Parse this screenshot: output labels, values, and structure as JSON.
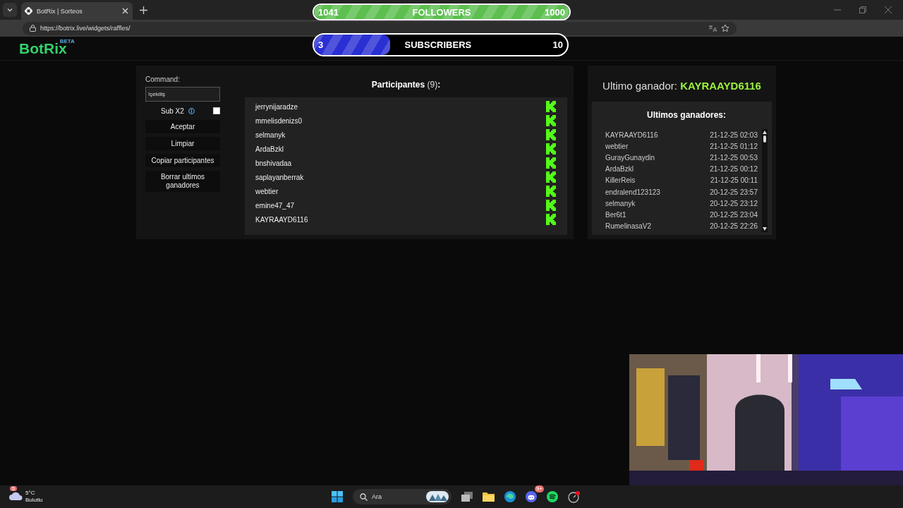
{
  "browser": {
    "tab_title": "BotRix | Sorteos",
    "url": "https://botrix.live/widgets/raffles/"
  },
  "goals": [
    {
      "current": "1041",
      "label": "FOLLOWERS",
      "target": "1000",
      "level": 1,
      "color": "#5cbf4f"
    },
    {
      "current": "3",
      "label": "SUBSCRIBERS",
      "target": "10",
      "level": 0.3,
      "color": "#2a2fd4"
    }
  ],
  "site": {
    "logo": "BotRix",
    "badge": "BETA"
  },
  "raffle": {
    "command_label": "Command:",
    "command_value": "!çekiliş",
    "sub_x2": {
      "label": "Sub X2",
      "checked": false
    },
    "buttons": [
      "Aceptar",
      "Limpiar",
      "Copiar participantes",
      "Borrar ultimos ganadores"
    ],
    "participants_title": "**Participantes** (9)**:**",
    "participants": [
      "jerrynijaradze",
      "mmelisdenizs0",
      "selmanyk",
      "ArdaBzkl",
      "bnshivadaa",
      "saplayanberrak",
      "webtier",
      "emine47_47",
      "KAYRAAYD6116"
    ]
  },
  "winner": {
    "label": "Ultimo ganador:",
    "name": "KAYRAAYD6116",
    "list_title": "Ultimos ganadores:",
    "winners": [
      {
        "name": "KAYRAAYD6116",
        "time": "21-12-25 02:03"
      },
      {
        "name": "webtier",
        "time": "21-12-25 01:12"
      },
      {
        "name": "GurayGunaydin",
        "time": "21-12-25 00:53"
      },
      {
        "name": "ArdaBzkl",
        "time": "21-12-25 00:12"
      },
      {
        "name": "KillerReis",
        "time": "21-12-25 00:11"
      },
      {
        "name": "endralend123123",
        "time": "20-12-25 23:57"
      },
      {
        "name": "selmanyk",
        "time": "20-12-25 23:12"
      },
      {
        "name": "Ber6t1",
        "time": "20-12-25 23:04"
      },
      {
        "name": "RumelinasaV2",
        "time": "20-12-25 22:26"
      }
    ]
  },
  "taskbar": {
    "weather_temp": "5°C",
    "weather_condition": "Bulutlu",
    "weather_badge": "5",
    "search_placeholder": "Ara",
    "chat_badge": "9+"
  }
}
